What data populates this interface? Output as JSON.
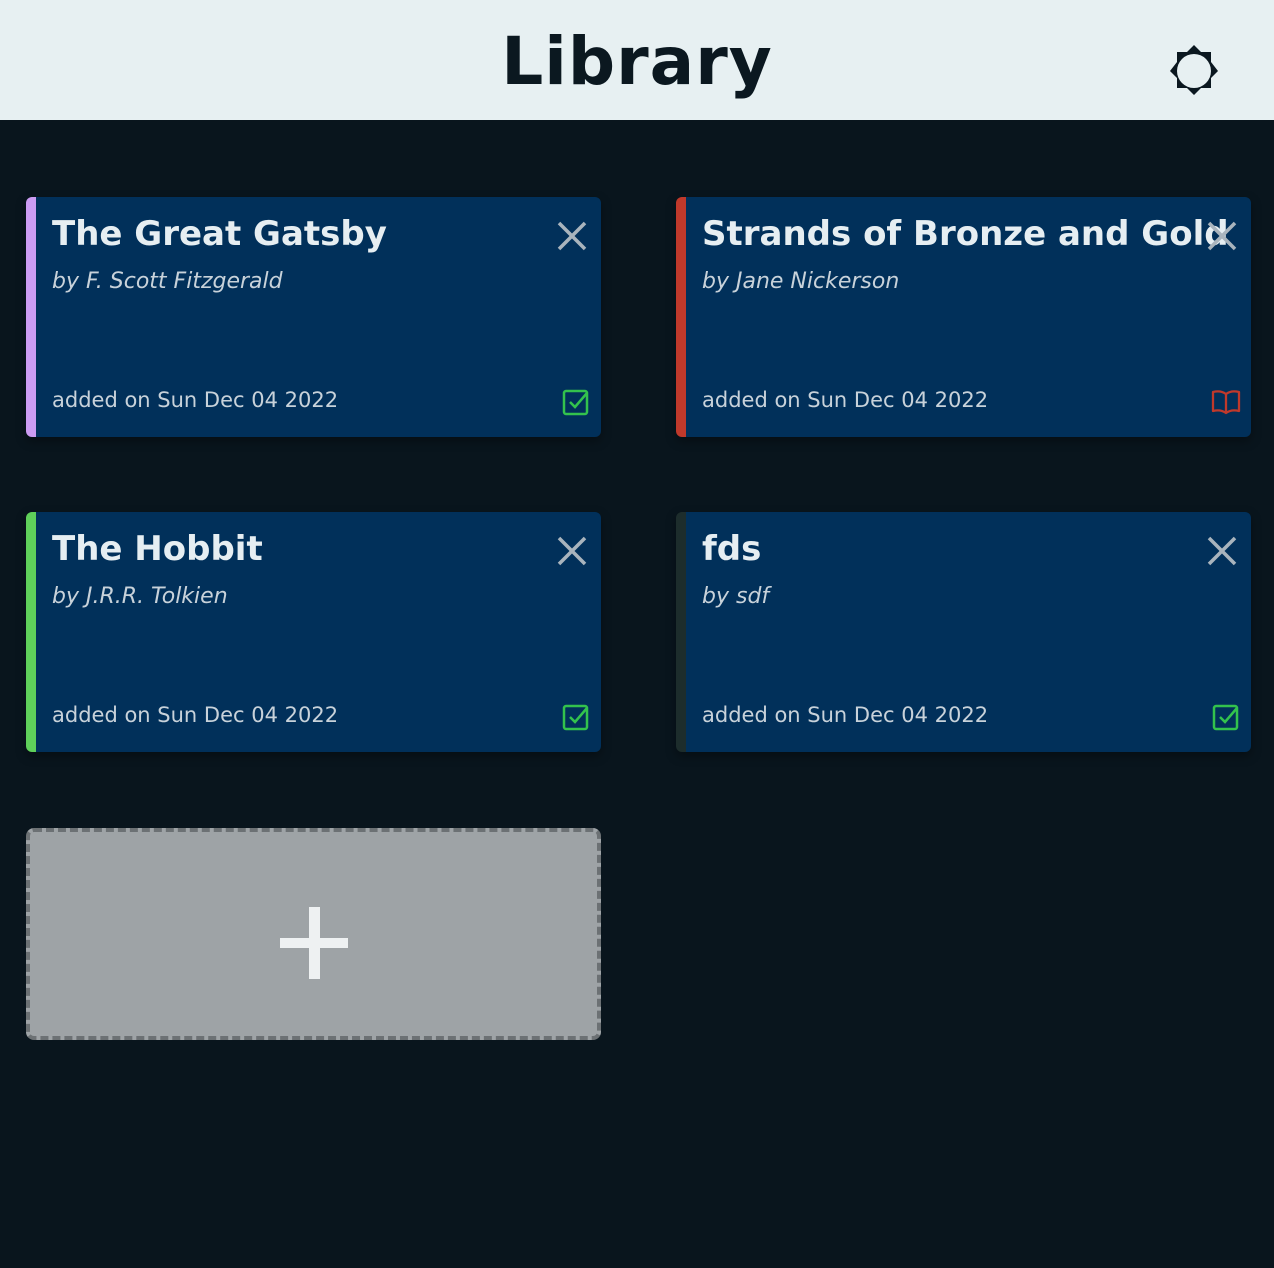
{
  "header": {
    "title": "Library",
    "theme_icon": "sun-outline-icon"
  },
  "colors": {
    "background": "#09151d",
    "header_bg": "#e7f0f2",
    "card_bg": "#01305a",
    "read_status": "#33c24d",
    "reading_status": "#c0392b",
    "add_card_bg": "#9ea3a6"
  },
  "books": [
    {
      "title": "The Great Gatsby",
      "author": "by F. Scott Fitzgerald",
      "added": "added on Sun Dec 04 2022",
      "accent": "#cc9cf3",
      "status": "read",
      "status_icon": "check-square-icon"
    },
    {
      "title": "Strands of Bronze and Gold",
      "author": "by Jane Nickerson",
      "added": "added on Sun Dec 04 2022",
      "accent": "#c0392b",
      "status": "reading",
      "status_icon": "open-book-icon"
    },
    {
      "title": "The Hobbit",
      "author": "by J.R.R. Tolkien",
      "added": "added on Sun Dec 04 2022",
      "accent": "#5fd05a",
      "status": "read",
      "status_icon": "check-square-icon"
    },
    {
      "title": "fds",
      "author": "by sdf",
      "added": "added on Sun Dec 04 2022",
      "accent": "#1d2d2c",
      "status": "read",
      "status_icon": "check-square-icon"
    }
  ],
  "add_card": {
    "icon": "plus-icon"
  }
}
